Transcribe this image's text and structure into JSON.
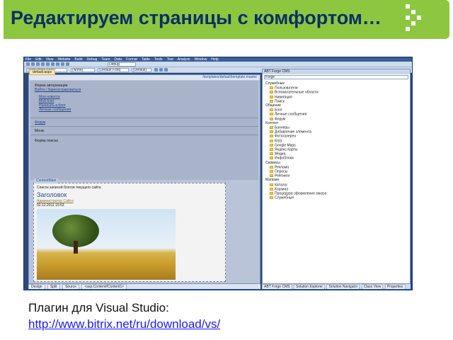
{
  "slide": {
    "title": "Редактируем страницы с комфортом…",
    "caption": "Плагин для Visual Studio:",
    "link": "http://www.bitrix.net/ru/download/vs/"
  },
  "vs": {
    "menu": [
      "File",
      "Edit",
      "View",
      "Website",
      "Build",
      "Debug",
      "Team",
      "Data",
      "Format",
      "Table",
      "Tools",
      "Test",
      "Analyze",
      "Window",
      "Help"
    ],
    "toolbar1": {
      "config": "Debug"
    },
    "toolbar2": {
      "style": "(New Inline Style)",
      "block": "(None)",
      "font": "(Default Font)",
      "size": "(Default)"
    },
    "doc_tab": "default.aspx",
    "path": "/templates/default/template.master",
    "master": {
      "heading": "Форма авторизации",
      "login_link": "Войти | Зарегистрироваться",
      "menu_items": [
        "Мои новости",
        "Мой блог",
        "Написать в блог",
        "Личные сообщения"
      ],
      "section1": "Форум",
      "section2": "Меню",
      "section3": "Форма поиска"
    },
    "content": {
      "header": "ContentMain",
      "line1": "Список записей блогов текущего сайта",
      "title": "Заголовок",
      "author": "Администратор Сайта",
      "date": "02.12.2011 15:53"
    },
    "bottom_tabs": [
      "Design",
      "Split",
      "Source",
      "<asp:Content#Content1>"
    ],
    "right_panel": {
      "title": "ABT Forge CMS",
      "combo": "Forge",
      "items": [
        {
          "label": "Служебные",
          "folder": false
        },
        {
          "label": "Пользователи",
          "folder": true
        },
        {
          "label": "Вспомогательные области",
          "folder": true
        },
        {
          "label": "Навигация",
          "folder": true
        },
        {
          "label": "Поиск",
          "folder": true
        },
        {
          "label": "Общение",
          "folder": false
        },
        {
          "label": "Блог",
          "folder": true
        },
        {
          "label": "Личные сообщения",
          "folder": true
        },
        {
          "label": "Форум",
          "folder": true
        },
        {
          "label": "Контент",
          "folder": false
        },
        {
          "label": "Баннеры",
          "folder": true
        },
        {
          "label": "Добавление элемента",
          "folder": true
        },
        {
          "label": "Фотогалерея",
          "folder": true
        },
        {
          "label": "RSS",
          "folder": true
        },
        {
          "label": "Google Maps",
          "folder": true
        },
        {
          "label": "Яндекс.Карты",
          "folder": true
        },
        {
          "label": "Медиа",
          "folder": true
        },
        {
          "label": "Инфоблоки",
          "folder": true
        },
        {
          "label": "Сервисы",
          "folder": false
        },
        {
          "label": "Реклама",
          "folder": true
        },
        {
          "label": "Опросы",
          "folder": true
        },
        {
          "label": "Рейтинги",
          "folder": true
        },
        {
          "label": "Магазин",
          "folder": false
        },
        {
          "label": "Каталог",
          "folder": true
        },
        {
          "label": "Корзина",
          "folder": true
        },
        {
          "label": "Процедура оформления заказа",
          "folder": true
        },
        {
          "label": "Служебные",
          "folder": true
        }
      ]
    },
    "right_tabs": [
      "ABT Forge CMS",
      "Solution Explorer",
      "Solution Navigator",
      "Class View",
      "Properties"
    ]
  }
}
